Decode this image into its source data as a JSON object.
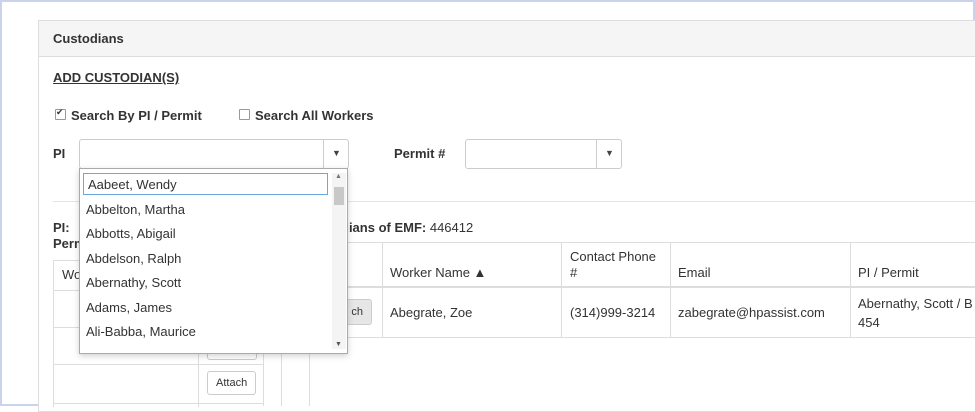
{
  "panel": {
    "title": "Custodians"
  },
  "add_link": "ADD CUSTODIAN(S)",
  "search_options": {
    "by_pi": {
      "label": "Search By PI / Permit",
      "checked": true
    },
    "all_workers": {
      "label": "Search All Workers",
      "checked": false
    }
  },
  "pi_field": {
    "label": "PI",
    "value": "",
    "arrow": "▼"
  },
  "permit_field": {
    "label": "Permit #",
    "value": "",
    "arrow": "▼"
  },
  "dropdown": {
    "search_value": "Aabeet, Wendy",
    "options": [
      "Abbelton, Martha",
      "Abbotts, Abigail",
      "Abdelson, Ralph",
      "Abernathy, Scott",
      "Adams, James",
      "Ali-Babba, Maurice"
    ]
  },
  "left_section": {
    "pi_label": "PI:",
    "permit_label": "Perm",
    "table_header": "Wo",
    "attach_label": "Attach"
  },
  "emf": {
    "label": "dians of EMF:",
    "value": "446412"
  },
  "custodians_table": {
    "columns": [
      "Worker Name ▲",
      "Contact Phone #",
      "Email",
      "PI / Permit"
    ],
    "rows": [
      {
        "action": "ch",
        "worker_name": "Abegrate, Zoe",
        "phone": "(314)999-3214",
        "email": "zabegrate@hpassist.com",
        "pi_permit_line1": "Abernathy, Scott / B",
        "pi_permit_line2": "454"
      }
    ]
  }
}
